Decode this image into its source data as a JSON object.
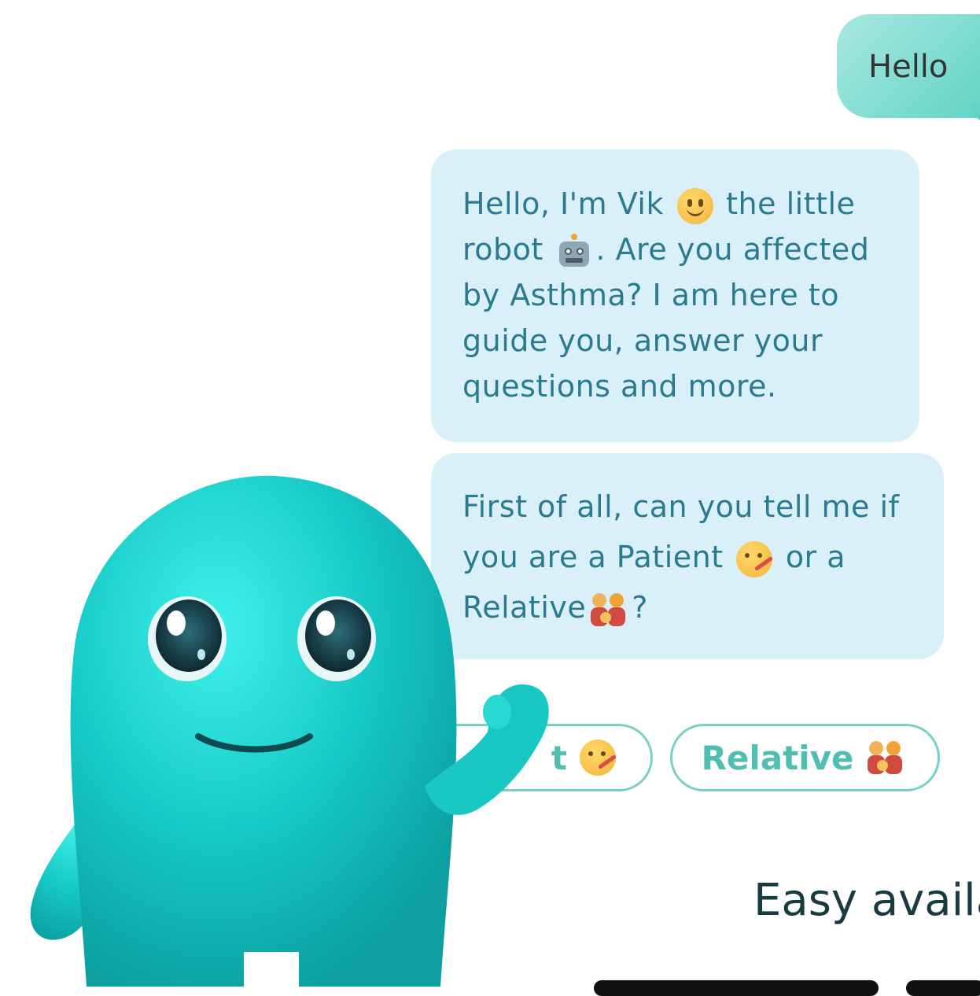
{
  "chat": {
    "user_message": "Hello",
    "bot_message_1": {
      "line1_a": "Hello, I'm Vik",
      "line1_b": "the little",
      "line2_a": "robot",
      "line2_b": ". Are you affected",
      "line3": "by Asthma? I am here to",
      "line4": "guide you, answer your",
      "line5": "questions and more."
    },
    "bot_message_2": {
      "line1": "First of all, can you tell me if",
      "line2_a": "you are a Patient",
      "line2_b": "or a",
      "line3_a": "Relative",
      "line3_b": "?"
    },
    "quick_replies": {
      "patient_label": "t",
      "relative_label": "Relative"
    }
  },
  "tagline": "Easy availa",
  "colors": {
    "user_bubble": "#5fd3c4",
    "bot_bubble": "#d9f0f8",
    "bot_text": "#2b7b8e",
    "quick_reply_border": "#79d1c6",
    "quick_reply_text": "#4fbfb1",
    "mascot": "#18c9c6",
    "tagline": "#173b3e"
  },
  "icons": [
    "slightly-smiling-face-icon",
    "robot-face-icon",
    "face-with-thermometer-icon",
    "family-icon"
  ]
}
